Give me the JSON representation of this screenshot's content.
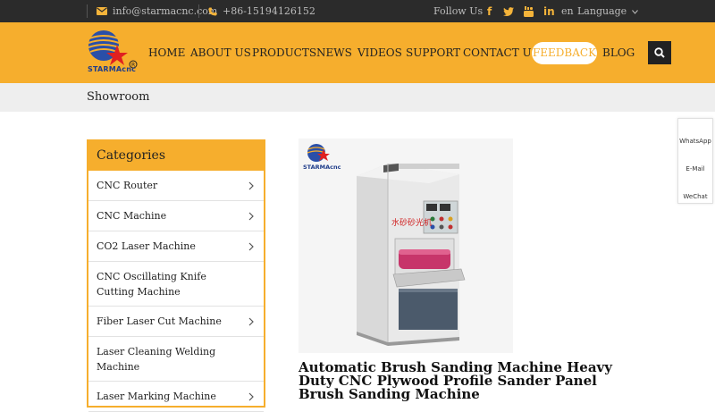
{
  "topbar": {
    "email": "info@starmacnc.com",
    "phone": "+86-15194126152",
    "follow_us": "Follow Us",
    "social_icons": [
      "facebook-icon",
      "twitter-icon",
      "youtube-icon",
      "linkedin-icon"
    ],
    "lang_code": "en",
    "language_label": "Language"
  },
  "logo": {
    "text": "STARMAcnc",
    "registered": "®"
  },
  "nav": {
    "items": [
      "HOME",
      "ABOUT US",
      "PRODUCTS",
      "NEWS",
      "VIDEOS",
      "SUPPORT",
      "CONTACT US"
    ],
    "feedback": "FEEDBACK",
    "blog": "BLOG"
  },
  "breadcrumb": {
    "current": "Showroom"
  },
  "categories": {
    "title": "Categories",
    "items": [
      {
        "label": "CNC Router"
      },
      {
        "label": "CNC Machine"
      },
      {
        "label": "CO2 Laser Machine"
      },
      {
        "label": "CNC Oscillating Knife Cutting Machine"
      },
      {
        "label": "Fiber Laser Cut Machine"
      },
      {
        "label": "Laser Cleaning Welding Machine"
      },
      {
        "label": "Laser Marking Machine"
      }
    ]
  },
  "product": {
    "title": "Automatic Brush Sanding Machine Heavy Duty CNC Plywood Profile Sander Panel Brush Sanding Machine",
    "image_logo_text": "STARMAcnc",
    "machine_label": "水砂砂光机"
  },
  "side_widget": {
    "items": [
      "WhatsApp",
      "E-Mail",
      "WeChat"
    ]
  },
  "colors": {
    "accent": "#f6ae2d",
    "topbar_bg": "#2b2b2b",
    "breadcrumb_bg": "#eeeeee"
  }
}
